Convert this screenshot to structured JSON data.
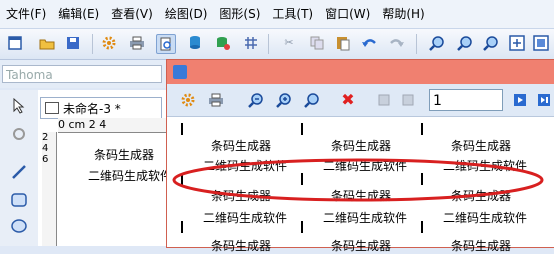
{
  "menu": [
    "文件(F)",
    "编辑(E)",
    "查看(V)",
    "绘图(D)",
    "图形(S)",
    "工具(T)",
    "窗口(W)",
    "帮助(H)"
  ],
  "font_field": {
    "value": "Tahoma"
  },
  "document": {
    "tab_title": "未命名-3 *",
    "ruler_top": "0 cm 2   4",
    "ruler_left": "2 4 6",
    "label_line1": "条码生成器",
    "label_line2": "二维码生成软件"
  },
  "preview": {
    "page_number": "1",
    "cells": {
      "line1": "条码生成器",
      "line2": "二维码生成软件"
    }
  },
  "colors": {
    "preview_title_bar": "#f08070",
    "annotation_ellipse": "#d82020"
  },
  "icons": {
    "toolbar": [
      "new-icon",
      "open-icon",
      "save-icon",
      "settings-icon",
      "print-icon",
      "print-preview-icon",
      "database-icon",
      "database-link-icon",
      "grid-icon",
      "cut-icon",
      "copy-icon",
      "paste-icon",
      "undo-icon",
      "redo-icon",
      "zoom-in-icon",
      "zoom-out-icon",
      "fit-icon",
      "zoom-page-icon"
    ],
    "preview_toolbar": [
      "settings-icon",
      "print-icon",
      "zoom-out-icon",
      "zoom-in-icon",
      "zoom-reset-icon",
      "close-icon",
      "first-page-icon",
      "prev-page-icon",
      "next-page-icon",
      "last-page-icon"
    ]
  }
}
